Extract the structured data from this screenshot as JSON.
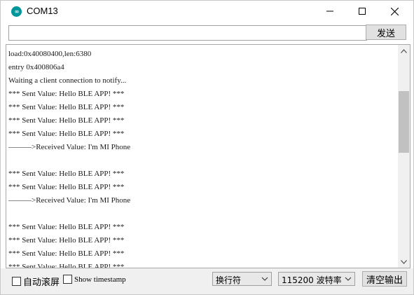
{
  "window": {
    "title": "COM13",
    "app_icon_glyph": "∞"
  },
  "icons": {
    "app": "arduino-icon",
    "minimize": "minimize-icon",
    "maximize": "maximize-icon",
    "close": "close-icon",
    "scroll_up": "chevron-up-icon",
    "scroll_down": "chevron-down-icon",
    "dropdown": "chevron-down-icon"
  },
  "colors": {
    "accent": "#00979c",
    "button_bg": "#e1e1e1",
    "toolbar_bg": "#f0f0f0",
    "scroll_thumb": "#c1c1c1"
  },
  "send": {
    "input_value": "",
    "button_label": "发送"
  },
  "serial_output": {
    "lines": [
      "load:0x40080400,len:6380",
      "entry 0x400806a4",
      "Waiting a client connection to notify...",
      "*** Sent Value: Hello BLE APP! ***",
      "*** Sent Value: Hello BLE APP! ***",
      "*** Sent Value: Hello BLE APP! ***",
      "*** Sent Value: Hello BLE APP! ***",
      "———>Received Value: I'm MI Phone",
      "",
      "*** Sent Value: Hello BLE APP! ***",
      "*** Sent Value: Hello BLE APP! ***",
      "———>Received Value: I'm MI Phone",
      "",
      "*** Sent Value: Hello BLE APP! ***",
      "*** Sent Value: Hello BLE APP! ***",
      "*** Sent Value: Hello BLE APP! ***",
      "*** Sent Value: Hello BLE APP! ***"
    ]
  },
  "footer": {
    "autoscroll_label": "自动滚屏",
    "autoscroll_checked": false,
    "timestamp_label": "Show timestamp",
    "timestamp_checked": false,
    "line_ending": "换行符",
    "baud_rate": "115200 波特率",
    "clear_button": "清空输出"
  }
}
